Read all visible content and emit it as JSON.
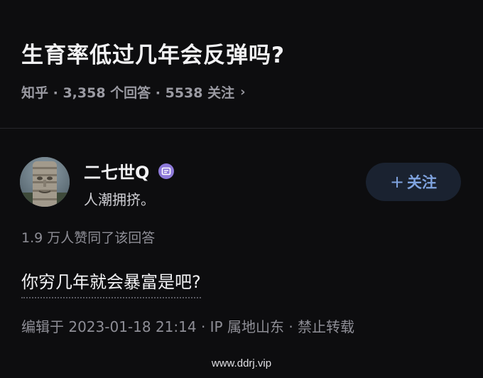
{
  "question": {
    "title": "生育率低过几年会反弹吗?",
    "meta": "知乎 · 3,358 个回答 · 5538 关注",
    "chevron": "›"
  },
  "answer": {
    "author": {
      "name": "二七世Q",
      "bio": "人潮拥挤。",
      "badge_icon": "verified-badge-icon",
      "avatar": "stone-face-avatar"
    },
    "follow_button": {
      "plus": "+",
      "label": "关注"
    },
    "votes": "1.9 万人赞同了该回答",
    "content": "你穷几年就会暴富是吧?",
    "edited": "编辑于 2023-01-18 21:14 · IP 属地山东 · 禁止转载"
  },
  "watermark": "www.ddrj.vip",
  "colors": {
    "background": "#0d0d0f",
    "follow_text": "#7fa3df",
    "follow_bg": "#1a2230",
    "badge": "#8d79d9"
  }
}
